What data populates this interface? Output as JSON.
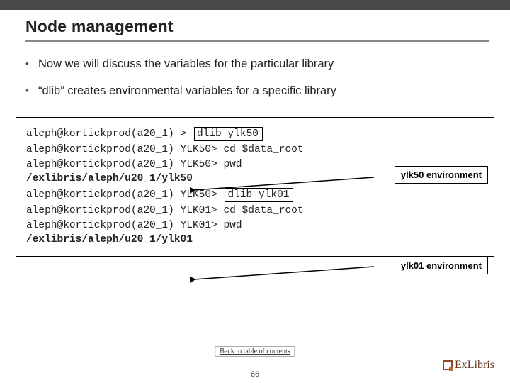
{
  "title": "Node management",
  "bullets": [
    "Now we will discuss the variables for the particular library",
    "“dlib” creates environmental variables for a specific library"
  ],
  "term": {
    "l1_prompt": "aleph@kortickprod(a20_1) >",
    "l1_cmd": "dlib ylk50",
    "l2": "aleph@kortickprod(a20_1) YLK50> cd $data_root",
    "l3": "aleph@kortickprod(a20_1) YLK50> pwd",
    "l4": "/exlibris/aleph/u20_1/ylk50",
    "l5_prompt": "aleph@kortickprod(a20_1) YLK50>",
    "l5_cmd": "dlib ylk01",
    "l6": "aleph@kortickprod(a20_1) YLK01> cd $data_root",
    "l7": "aleph@kortickprod(a20_1) YLK01> pwd",
    "l8": "/exlibris/aleph/u20_1/ylk01"
  },
  "badges": {
    "b1": "ylk50 environment",
    "b2": "ylk01 environment"
  },
  "footer": {
    "back": "Back to table of contents",
    "page": "66",
    "logo": "ExLibris"
  }
}
